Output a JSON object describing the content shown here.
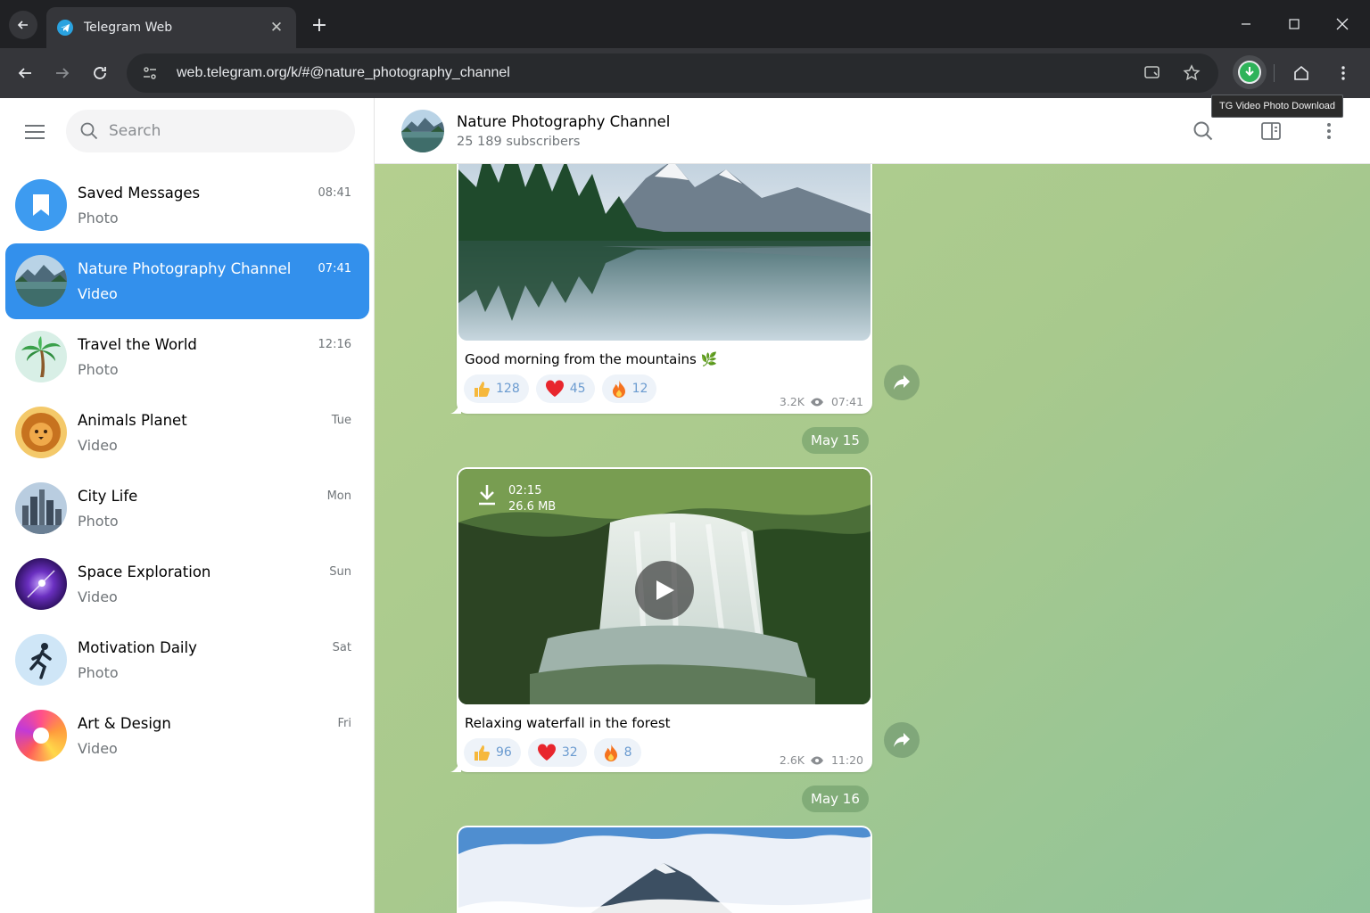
{
  "browser": {
    "tab_title": "Telegram Web",
    "url": "web.telegram.org/k/#@nature_photography_channel",
    "extension_tooltip": "TG Video Photo Download"
  },
  "sidebar": {
    "search_placeholder": "Search",
    "chats": [
      {
        "name": "Saved Messages",
        "subtitle": "Photo",
        "time": "08:41",
        "avatar": "bookmark-icon"
      },
      {
        "name": "Nature Photography Channel",
        "subtitle": "Video",
        "time": "07:41",
        "avatar": "mountain-lake",
        "active": true
      },
      {
        "name": "Travel the World",
        "subtitle": "Photo",
        "time": "12:16",
        "avatar": "palm-tree"
      },
      {
        "name": "Animals Planet",
        "subtitle": "Video",
        "time": "Tue",
        "avatar": "lion"
      },
      {
        "name": "City Life",
        "subtitle": "Photo",
        "time": "Mon",
        "avatar": "city-skyline"
      },
      {
        "name": "Space Exploration",
        "subtitle": "Video",
        "time": "Sun",
        "avatar": "galaxy"
      },
      {
        "name": "Motivation Daily",
        "subtitle": "Photo",
        "time": "Sat",
        "avatar": "runner"
      },
      {
        "name": "Art & Design",
        "subtitle": "Video",
        "time": "Fri",
        "avatar": "color-ring"
      }
    ]
  },
  "channel": {
    "title": "Nature Photography Channel",
    "subscribers": "25 189 subscribers"
  },
  "messages": [
    {
      "caption": "Good morning from the mountains 🌿",
      "reactions": [
        {
          "emoji": "thumbs-up",
          "count": "128"
        },
        {
          "emoji": "heart",
          "count": "45"
        },
        {
          "emoji": "fire",
          "count": "12"
        }
      ],
      "views": "3.2K",
      "time": "07:41"
    },
    {
      "duration": "02:15",
      "size": "26.6 MB",
      "caption": "Relaxing waterfall in the forest",
      "reactions": [
        {
          "emoji": "thumbs-up",
          "count": "96"
        },
        {
          "emoji": "heart",
          "count": "32"
        },
        {
          "emoji": "fire",
          "count": "8"
        }
      ],
      "views": "2.6K",
      "time": "11:20"
    }
  ],
  "dates": {
    "first": "May 15",
    "second": "May 16"
  },
  "colors": {
    "accent": "#3390ec",
    "chat_bg": "#a9c98c",
    "reaction_bg": "#eef3f9"
  }
}
